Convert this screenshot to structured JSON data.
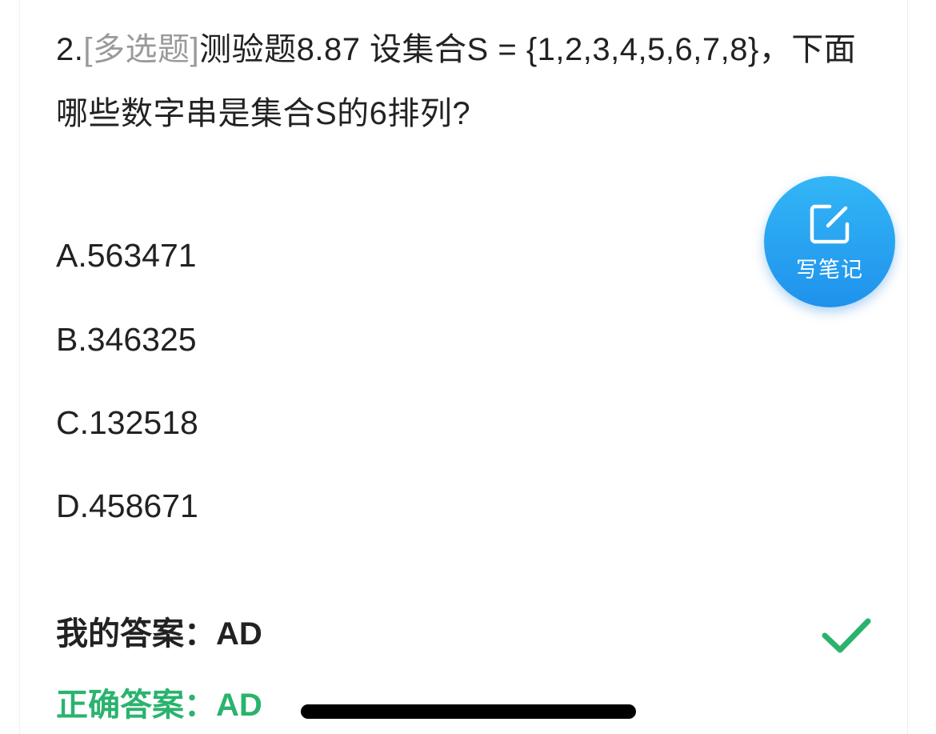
{
  "question": {
    "number": "2.",
    "type_tag": "[多选题]",
    "text": "测验题8.87 设集合S = {1,2,3,4,5,6,7,8}，下面哪些数字串是集合S的6排列?"
  },
  "options": [
    {
      "label": "A.563471"
    },
    {
      "label": "B.346325"
    },
    {
      "label": "C.132518"
    },
    {
      "label": "D.458671"
    }
  ],
  "note_button": {
    "label": "写笔记",
    "icon": "edit-note-icon",
    "color": "#2a9ff0"
  },
  "answers": {
    "mine": "我的答案：AD",
    "correct": "正确答案：AD",
    "status_icon": "check-icon",
    "correct_color": "#2ab36e"
  }
}
